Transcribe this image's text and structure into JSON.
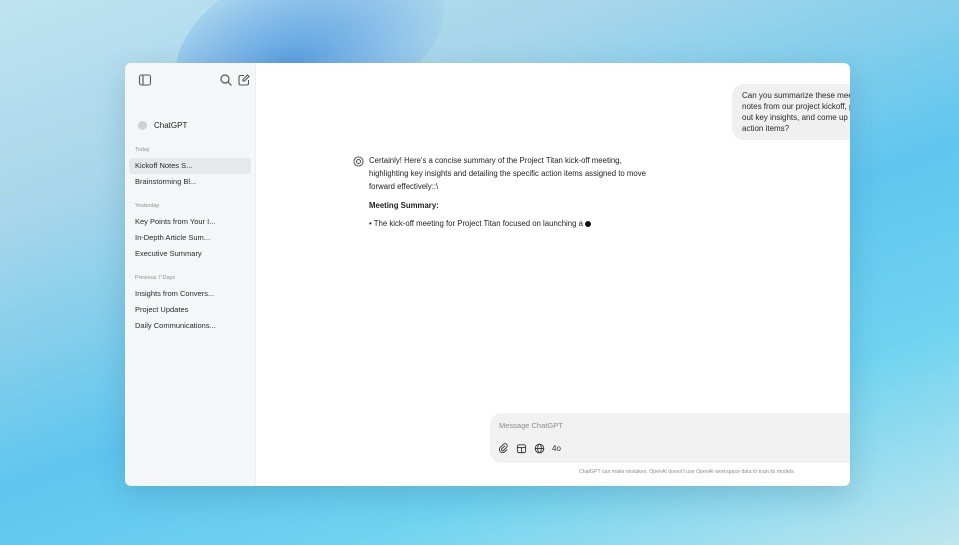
{
  "sidebar": {
    "brand_label": "ChatGPT",
    "sections": [
      {
        "label": "Today",
        "items": [
          "Kickoff Notes S...",
          "Brainstorming Bl..."
        ]
      },
      {
        "label": "Yesterday",
        "items": [
          "Key Points from Your I...",
          "In-Depth Article Sum...",
          "Executive Summary"
        ]
      },
      {
        "label": "Previous 7 Days",
        "items": [
          "Insights from Convers...",
          "Project Updates",
          "Daily Communications..."
        ]
      }
    ]
  },
  "conversation": {
    "user_message": "Can you summarize these meeting notes from our project kickoff, pull out key insights, and come up with action items?",
    "assistant_intro": "Certainly! Here's a concise summary of the Project Titan kick-off meeting, highlighting key insights and detailing the specific action items assigned to move forward effectively::\\",
    "assistant_heading": "Meeting Summary:",
    "assistant_bullet": "• The kick-off meeting for Project Titan focused on launching a"
  },
  "composer": {
    "placeholder": "Message ChatGPT",
    "model_label": "4o"
  },
  "disclaimer": "ChatGPT can make mistakes. OpenAI doesn't use OpenAI workspace data to train its models.",
  "colors": {
    "sidebar_bg": "#f5f6f7",
    "active_item_bg": "#e6e8ea",
    "bubble_bg": "#f0f0f0",
    "composer_bg": "#f1f1f1"
  }
}
